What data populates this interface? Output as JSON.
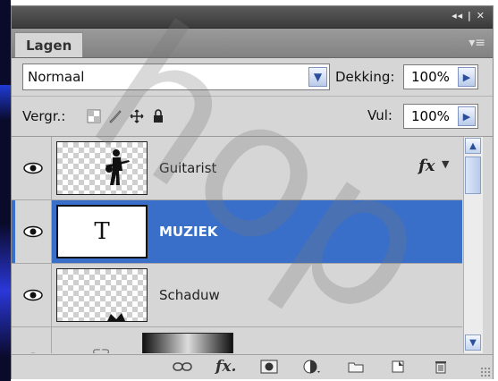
{
  "panel": {
    "title_controls": "◂◂ | ✕",
    "tab_label": "Lagen",
    "menu_icon": "panel-menu-icon"
  },
  "blend_mode": {
    "value": "Normaal"
  },
  "opacity": {
    "label": "Dekking:",
    "value": "100%"
  },
  "lock": {
    "label": "Vergr.:"
  },
  "fill": {
    "label": "Vul:",
    "value": "100%"
  },
  "layers": [
    {
      "name": "Guitarist",
      "visible": true,
      "has_fx": true,
      "fx_label": "fx",
      "thumb": "guitarist-silhouette"
    },
    {
      "name": "MUZIEK",
      "visible": true,
      "type_layer": true,
      "thumb_glyph": "T",
      "selected": true
    },
    {
      "name": "Schaduw",
      "visible": true,
      "thumb": "shadow-shape"
    },
    {
      "name": "",
      "visible": true,
      "thumb": "gradient",
      "partially_visible": true
    }
  ],
  "bottom_icons": [
    "link-icon",
    "fx-icon",
    "mask-icon",
    "adjustment-icon",
    "group-folder-icon",
    "new-layer-icon",
    "trash-icon"
  ],
  "bottom_fx_label": "fx.",
  "watermark_text": "hop",
  "colors": {
    "selection": "#3a6fc9",
    "panel_bg": "#d6d6d6",
    "titlebar": "#444444"
  }
}
